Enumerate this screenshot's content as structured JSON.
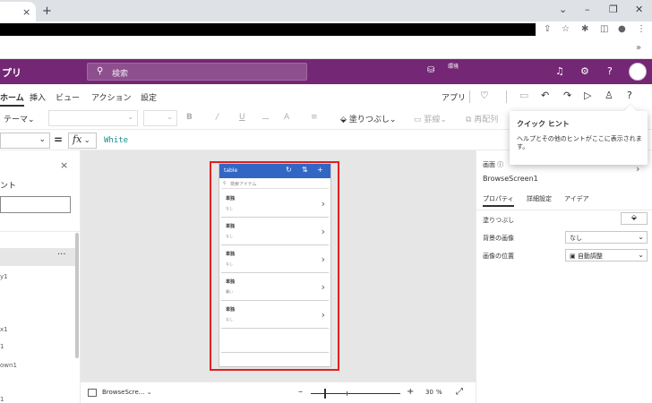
{
  "browser": {
    "tab_close": "×",
    "new_tab": "+",
    "window_controls": [
      "⌄",
      "–",
      "❐",
      "✕"
    ],
    "bookmark_overflow": "»"
  },
  "header": {
    "app_name": "プリ",
    "search_placeholder": "検索",
    "environment_label": "環境",
    "accent_color": "#742774"
  },
  "menu": {
    "items": [
      "ホーム",
      "挿入",
      "ビュー",
      "アクション",
      "設定"
    ],
    "active": "ホーム",
    "app_label": "アプリ"
  },
  "toolbar": {
    "theme_label": "テーマ",
    "bold": "B",
    "italic": "/",
    "underline": "U",
    "strike": "ー",
    "font_color": "A",
    "align": "≡",
    "fill_label": "塗りつぶし",
    "border_label": "罫線",
    "reorder_label": "再配列"
  },
  "formula": {
    "equals": "=",
    "fx": "fx",
    "value": "White"
  },
  "tree": {
    "close": "×",
    "title_fragment": "ント",
    "more": "···",
    "nodes": [
      "y1",
      "x1",
      "1",
      "own1",
      "1"
    ]
  },
  "canvas": {
    "gallery_title": "table",
    "gallery_header_color": "#3266c4",
    "search_placeholder": "検索アイテム",
    "items": [
      {
        "title": "単独",
        "subtitle": "なし"
      },
      {
        "title": "単独",
        "subtitle": "なし"
      },
      {
        "title": "単独",
        "subtitle": "なし"
      },
      {
        "title": "単独",
        "subtitle": "暑い"
      },
      {
        "title": "単独",
        "subtitle": "なし"
      }
    ]
  },
  "statusbar": {
    "screen_name": "BrowseScre...",
    "zoom_minus": "–",
    "zoom_plus": "+",
    "zoom_value": "30",
    "zoom_unit": "%"
  },
  "properties": {
    "section_label": "画面",
    "screen_name": "BrowseScreen1",
    "tabs": [
      "プロパティ",
      "詳細設定",
      "アイデア"
    ],
    "active_tab": "プロパティ",
    "fill_label": "塗りつぶし",
    "bg_image_label": "背景の画像",
    "bg_image_value": "なし",
    "image_position_label": "画像の位置",
    "image_position_value": "自動調整"
  },
  "tooltip": {
    "title": "クイック ヒント",
    "body": "ヘルプとその他のヒントがここに表示されます。"
  }
}
